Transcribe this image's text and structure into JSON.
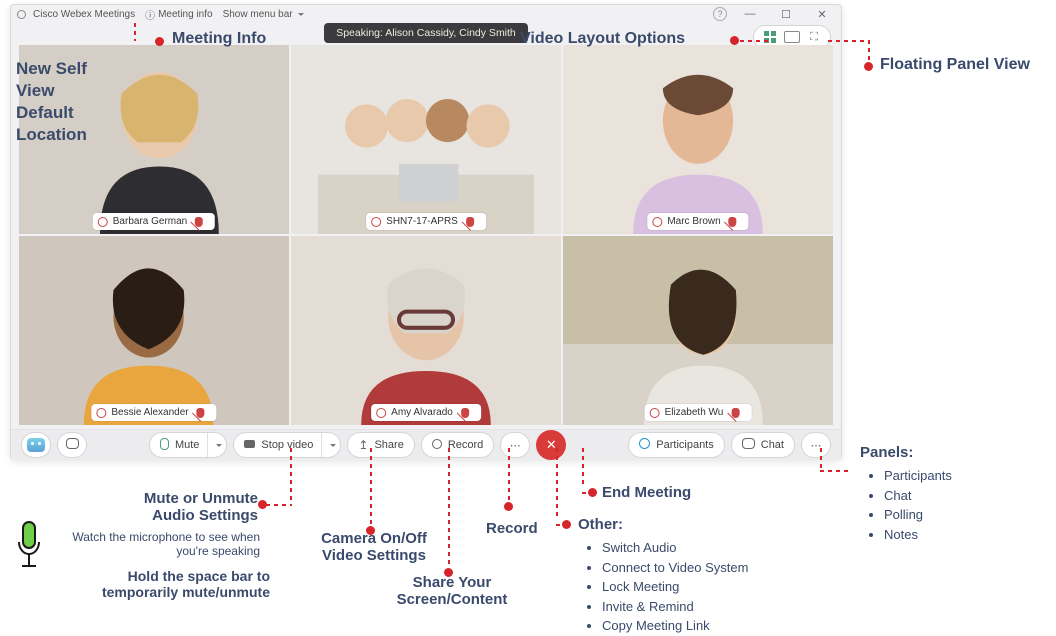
{
  "titlebar": {
    "app_name": "Cisco Webex Meetings",
    "meeting_info_label": "Meeting info",
    "menu_bar_label": "Show menu bar"
  },
  "speaking_banner": "Speaking: Alison Cassidy, Cindy Smith",
  "selfview_label_lines": [
    "New Self",
    "View",
    "Default",
    "Location"
  ],
  "participants": [
    {
      "name": "Barbara German",
      "muted": true
    },
    {
      "name": "SHN7-17-APRS",
      "muted": true
    },
    {
      "name": "Marc Brown",
      "muted": true
    },
    {
      "name": "Bessie Alexander",
      "muted": true
    },
    {
      "name": "Amy Alvarado",
      "muted": true
    },
    {
      "name": "Elizabeth Wu",
      "muted": true
    }
  ],
  "bottombar": {
    "mute": "Mute",
    "stopvideo": "Stop video",
    "share": "Share",
    "record": "Record",
    "participants": "Participants",
    "chat": "Chat"
  },
  "annotations": {
    "meeting_info": "Meeting Info",
    "video_layout": "Video Layout Options",
    "floating_panel": "Floating Panel View",
    "mute_heading": "Mute or Unmute Audio Settings",
    "mute_sub1": "Watch the microphone to see when you're speaking",
    "mute_sub2": "Hold the space bar to temporarily mute/unmute",
    "camera": "Camera On/Off Video Settings",
    "share": "Share Your Screen/Content",
    "record": "Record",
    "end": "End Meeting",
    "other_heading": "Other:",
    "other_items": [
      "Switch Audio",
      "Connect to Video System",
      "Lock Meeting",
      "Invite & Remind",
      "Copy Meeting Link"
    ],
    "panels_heading": "Panels:",
    "panels_items": [
      "Participants",
      "Chat",
      "Polling",
      "Notes"
    ]
  }
}
